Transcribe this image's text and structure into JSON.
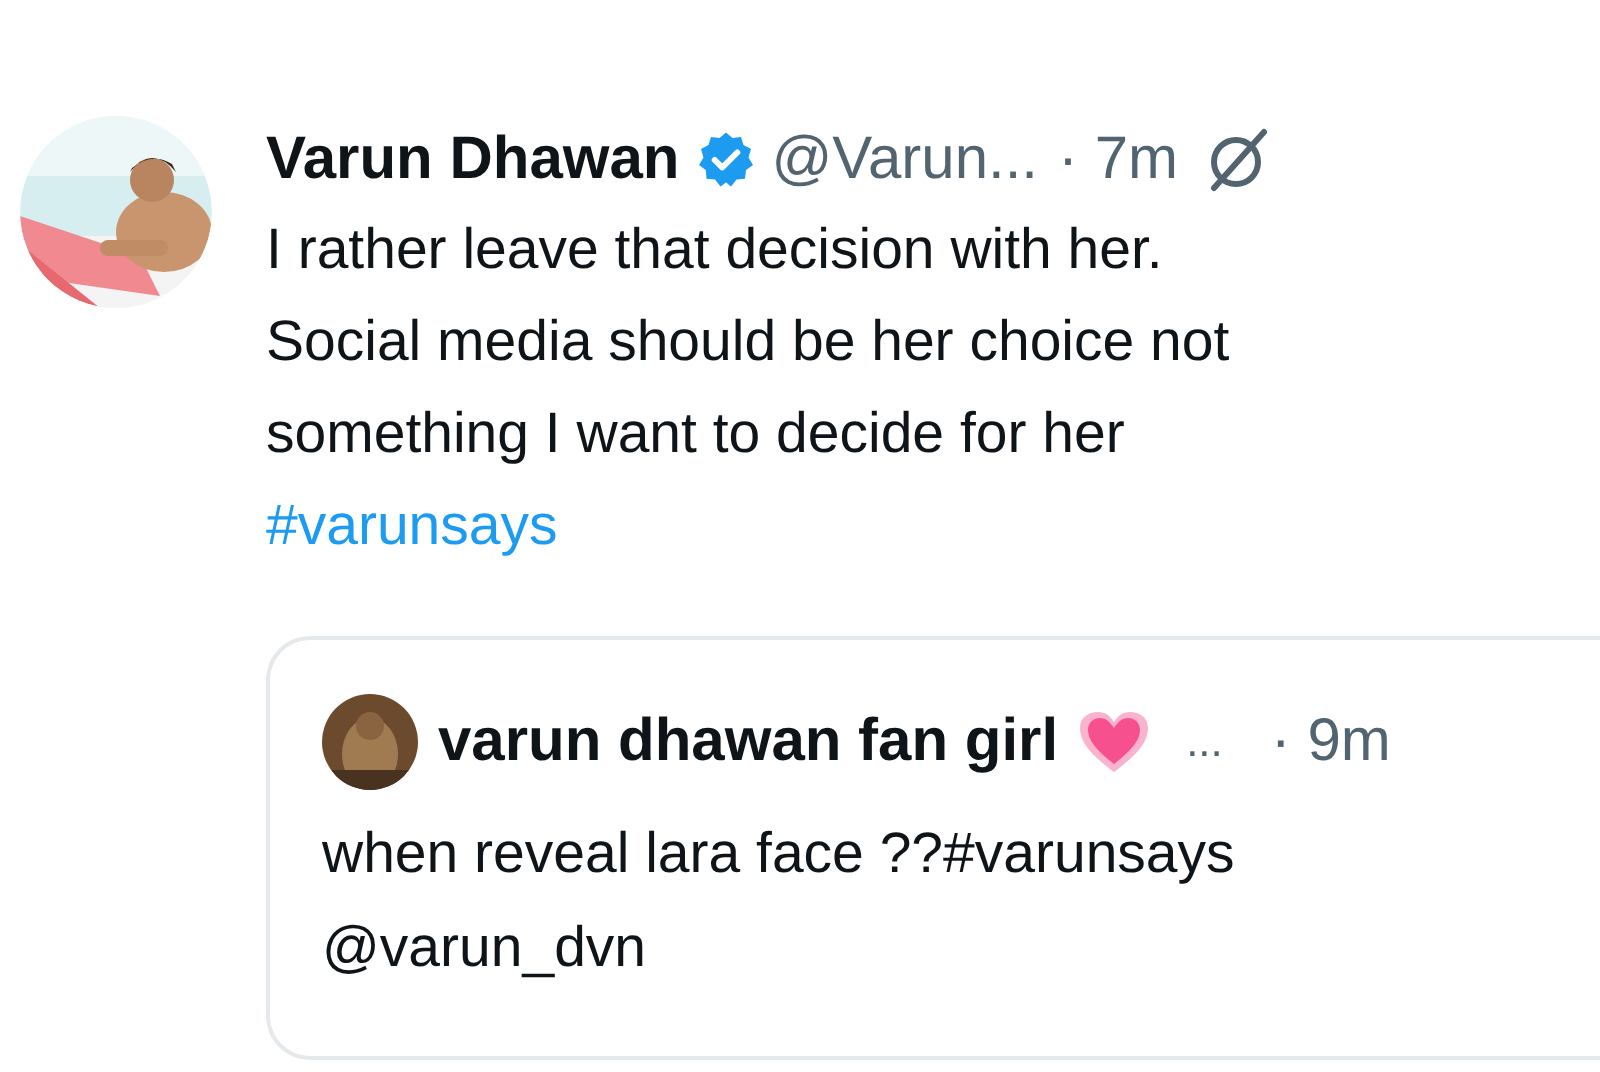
{
  "tweet": {
    "author": "Varun Dhawan",
    "verified": true,
    "handle": "@Varun...",
    "time": "· 7m",
    "text": "I rather leave that decision with her.\nSocial media should be her choice not\nsomething I want to decide for her",
    "hashtag": "#varunsays"
  },
  "quoted_tweet": {
    "author": "varun dhawan fan girl",
    "more": "...",
    "time": "· 9m",
    "text": "when reveal lara face ??#varunsays\n@varun_dvn"
  }
}
